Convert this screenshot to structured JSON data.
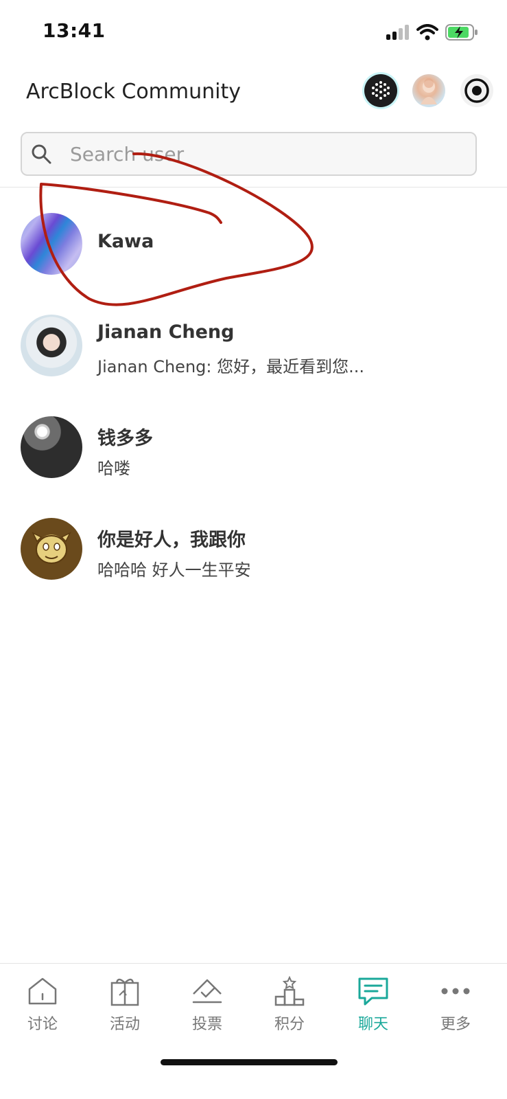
{
  "status_bar": {
    "time": "13:41"
  },
  "header": {
    "title": "ArcBlock Community"
  },
  "search": {
    "placeholder": "Search user"
  },
  "chats": [
    {
      "name": "Kawa",
      "preview": ""
    },
    {
      "name": "Jianan Cheng",
      "preview": "Jianan Cheng: 您好，最近看到您..."
    },
    {
      "name": "钱多多",
      "preview": "哈喽"
    },
    {
      "name": "你是好人，我跟你",
      "preview": "哈哈哈 好人一生平安"
    }
  ],
  "nav": {
    "items": [
      {
        "label": "讨论",
        "icon": "home-icon"
      },
      {
        "label": "活动",
        "icon": "gift-icon"
      },
      {
        "label": "投票",
        "icon": "vote-icon"
      },
      {
        "label": "积分",
        "icon": "podium-icon"
      },
      {
        "label": "聊天",
        "icon": "chat-icon"
      },
      {
        "label": "更多",
        "icon": "more-icon"
      }
    ],
    "active": "聊天"
  },
  "colors": {
    "accent": "#1aa89a",
    "annotation": "#b01e12"
  }
}
